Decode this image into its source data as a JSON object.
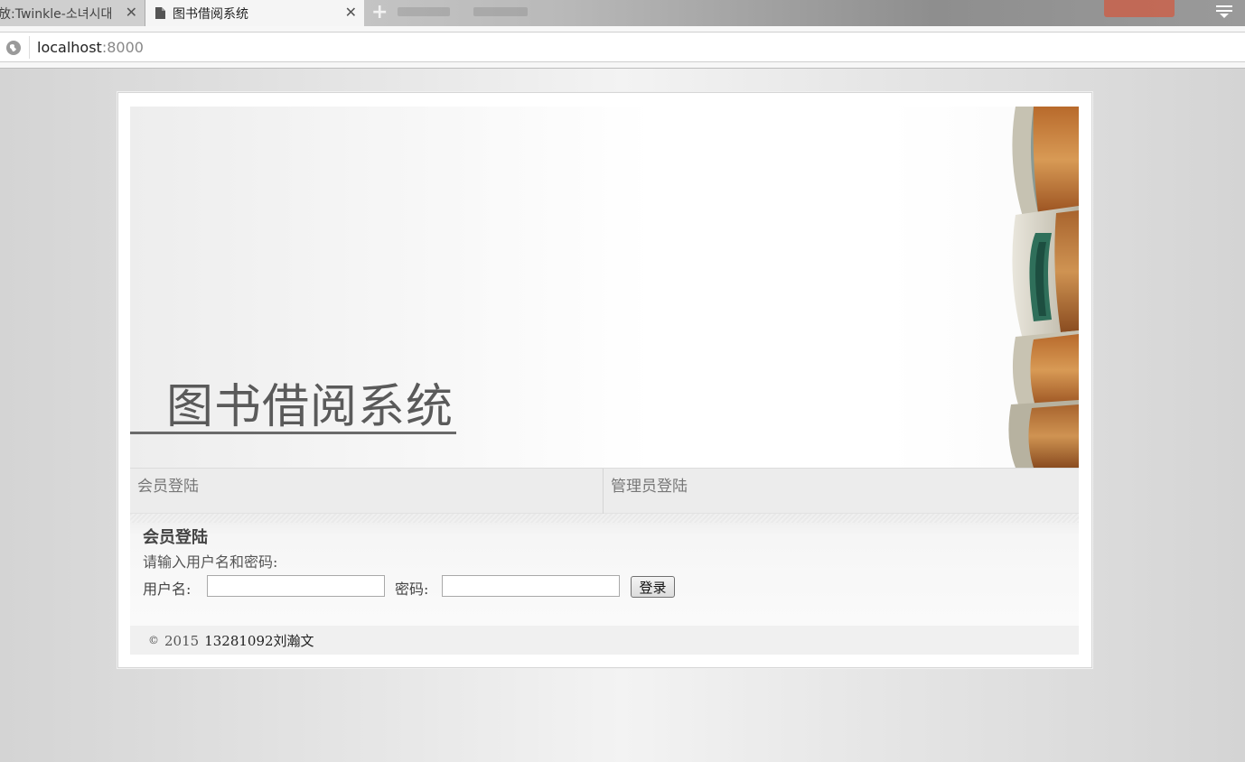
{
  "browser": {
    "tabs": [
      {
        "title": "放:Twinkle-소녀시대",
        "active": false
      },
      {
        "title": "图书借阅系统",
        "active": true
      }
    ],
    "close_glyph": "✕",
    "new_tab_glyph": "+",
    "url_host": "localhost",
    "url_port": ":8000"
  },
  "banner": {
    "title": "图书借阅系统"
  },
  "login_tabs": {
    "member": "会员登陆",
    "admin": "管理员登陆"
  },
  "form": {
    "heading": "会员登陆",
    "hint": "请输入用户名和密码:",
    "username_label": "用户名:",
    "password_label": "密码:",
    "username_value": "",
    "password_value": "",
    "submit_label": "登录"
  },
  "footer": {
    "copyright_symbol": "©",
    "year": "2015",
    "author": "13281092刘瀚文"
  }
}
